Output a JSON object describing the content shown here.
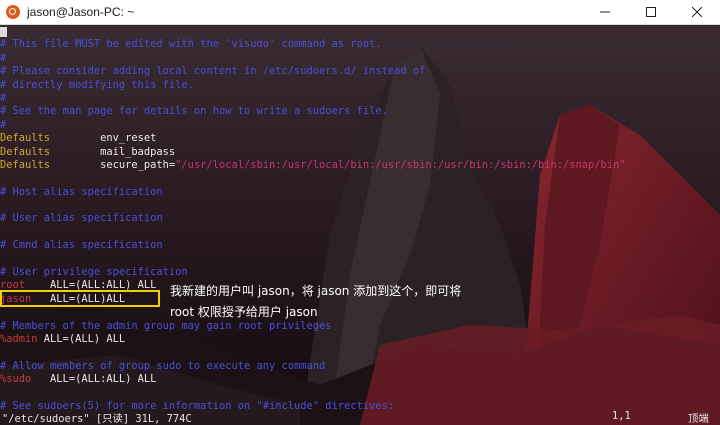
{
  "window": {
    "title": "jason@Jason-PC: ~",
    "minimize_label": "—",
    "maximize_label": "☐",
    "close_label": "✕"
  },
  "terminal": {
    "lines": [
      {
        "t": "",
        "c": "c-plain"
      },
      {
        "t": "# This file MUST be edited with the 'visudo' command as root.",
        "c": "c-comment"
      },
      {
        "t": "#",
        "c": "c-comment"
      },
      {
        "t": "# Please consider adding local content in /etc/sudoers.d/ instead of",
        "c": "c-comment"
      },
      {
        "t": "# directly modifying this file.",
        "c": "c-comment"
      },
      {
        "t": "#",
        "c": "c-comment"
      },
      {
        "t": "# See the man page for details on how to write a sudoers file.",
        "c": "c-comment"
      },
      {
        "t": "#",
        "c": "c-comment"
      },
      {
        "t": "Defaults        env_reset",
        "c": "c-keyword",
        "split": [
          [
            "Defaults",
            "c-keyword"
          ],
          [
            "        env_reset",
            "c-plain"
          ]
        ]
      },
      {
        "t": "Defaults        mail_badpass",
        "c": "c-keyword",
        "split": [
          [
            "Defaults",
            "c-keyword"
          ],
          [
            "        mail_badpass",
            "c-plain"
          ]
        ]
      },
      {
        "t": "Defaults        secure_path=\"/usr/local/sbin:/usr/local/bin:/usr/sbin:/usr/bin:/sbin:/bin:/snap/bin\"",
        "c": "c-keyword",
        "split": [
          [
            "Defaults",
            "c-keyword"
          ],
          [
            "        secure_path=",
            "c-plain"
          ],
          [
            "\"/usr/local/sbin:/usr/local/bin:/usr/sbin:/usr/bin:/sbin:/bin:/snap/bin\"",
            "c-string"
          ]
        ]
      },
      {
        "t": "",
        "c": "c-plain"
      },
      {
        "t": "# Host alias specification",
        "c": "c-comment"
      },
      {
        "t": "",
        "c": "c-plain"
      },
      {
        "t": "# User alias specification",
        "c": "c-comment"
      },
      {
        "t": "",
        "c": "c-plain"
      },
      {
        "t": "# Cmnd alias specification",
        "c": "c-comment"
      },
      {
        "t": "",
        "c": "c-plain"
      },
      {
        "t": "# User privilege specification",
        "c": "c-comment"
      },
      {
        "t": "root    ALL=(ALL:ALL) ALL",
        "c": "c-plain",
        "split": [
          [
            "root",
            "c-user"
          ],
          [
            "    ALL=(ALL:ALL) ALL",
            "c-plain"
          ]
        ]
      },
      {
        "t": "jason   ALL=(ALL)ALL",
        "c": "c-plain",
        "split": [
          [
            "jason",
            "c-user"
          ],
          [
            "   ALL=(ALL)ALL",
            "c-plain"
          ]
        ]
      },
      {
        "t": "",
        "c": "c-plain"
      },
      {
        "t": "# Members of the admin group may gain root privileges",
        "c": "c-comment"
      },
      {
        "t": "%admin ALL=(ALL) ALL",
        "c": "c-plain",
        "split": [
          [
            "%admin",
            "c-user"
          ],
          [
            " ALL=(ALL) ALL",
            "c-plain"
          ]
        ]
      },
      {
        "t": "",
        "c": "c-plain"
      },
      {
        "t": "# Allow members of group sudo to execute any command",
        "c": "c-comment"
      },
      {
        "t": "%sudo   ALL=(ALL:ALL) ALL",
        "c": "c-plain",
        "split": [
          [
            "%sudo",
            "c-user"
          ],
          [
            "   ALL=(ALL:ALL) ALL",
            "c-plain"
          ]
        ]
      },
      {
        "t": "",
        "c": "c-plain"
      },
      {
        "t": "# See sudoers(5) for more information on \"#include\" directives:",
        "c": "c-comment"
      }
    ],
    "status": {
      "file_info": "\"/etc/sudoers\" [只读] 31L, 774C",
      "cursor_pos": "1,1",
      "scroll": "顶端"
    }
  },
  "annotation": {
    "line1": "我新建的用户叫 jason，将 jason 添加到这个，即可将",
    "line2": "root 权限授予给用户 jason",
    "box_color": "#f0d000"
  },
  "colors": {
    "comment": "#4b4fd8",
    "keyword": "#d1a72c",
    "string": "#c7356b",
    "user": "#c23c40",
    "text": "#e8e8e8"
  }
}
